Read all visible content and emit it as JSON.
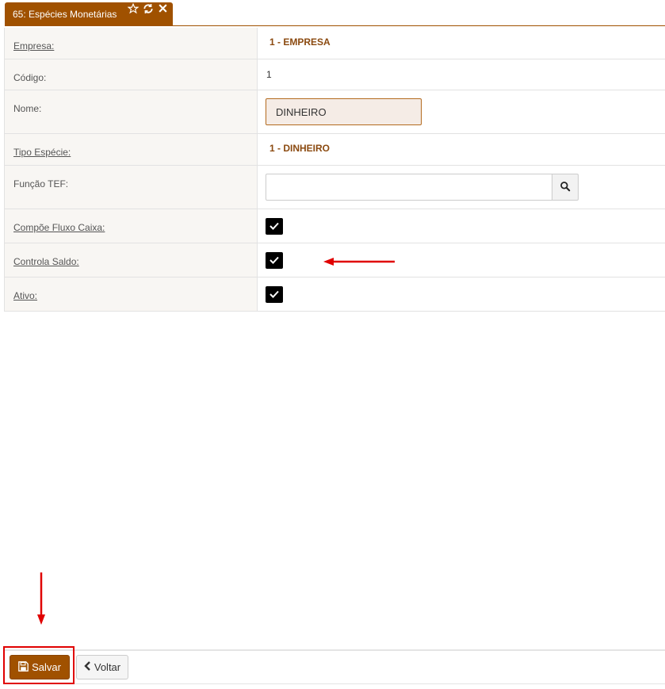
{
  "tab": {
    "title": "65: Espécies Monetárias",
    "icons": [
      "star-icon",
      "refresh-icon",
      "close-icon"
    ],
    "color": "#a05100"
  },
  "form": {
    "empresa": {
      "label": "Empresa:",
      "value": "1 - EMPRESA"
    },
    "codigo": {
      "label": "Código:",
      "value": "1"
    },
    "nome": {
      "label": "Nome:",
      "value": "DINHEIRO"
    },
    "tipo_especie": {
      "label": "Tipo Espécie:",
      "value": "1 - DINHEIRO"
    },
    "funcao_tef": {
      "label": "Função TEF:",
      "value": "",
      "button_icon": "search-icon"
    },
    "compoe_fluxo_caixa": {
      "label": "Compõe Fluxo Caixa:",
      "checked": true
    },
    "controla_saldo": {
      "label": "Controla Saldo:",
      "checked": true
    },
    "ativo": {
      "label": "Ativo:",
      "checked": true
    }
  },
  "footer": {
    "save_label": "Salvar",
    "save_icon": "floppy-disk-icon",
    "back_label": "Voltar",
    "back_icon": "chevron-left-icon"
  },
  "annotations": {
    "color": "#e00000",
    "arrow_controla_saldo": "arrow-left",
    "arrow_save": "arrow-down"
  }
}
